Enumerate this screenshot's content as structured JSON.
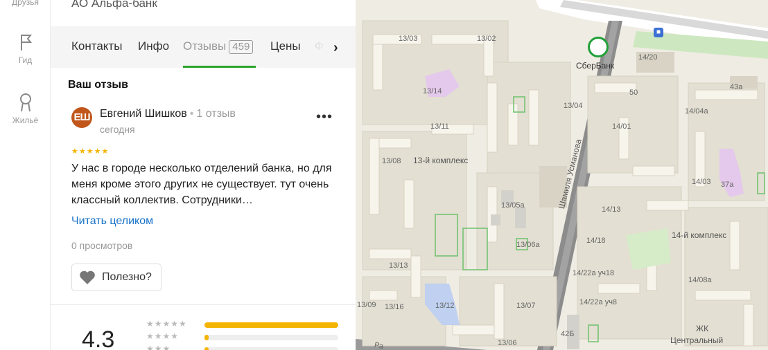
{
  "rail": {
    "friends_label": "Друзья",
    "guide_label": "Гид",
    "housing_label": "Жильё"
  },
  "org": {
    "name": "АО Альфа-банк"
  },
  "tabs": [
    {
      "label": "Контакты"
    },
    {
      "label": "Инфо"
    },
    {
      "label": "Отзывы",
      "count": "459"
    },
    {
      "label": "Цены"
    },
    {
      "label": "Ф"
    }
  ],
  "review": {
    "section_title": "Ваш отзыв",
    "avatar_initials": "ЕШ",
    "author": "Евгений Шишков",
    "separator": "•",
    "author_reviews": "1 отзыв",
    "date": "сегодня",
    "stars": "★★★★★",
    "rating": 5,
    "text": "У нас в городе несколько отделений банка, но для меня кроме этого других не существует. тут очень классный коллектив. Сотрудники…",
    "read_full": "Читать целиком",
    "views": "0 просмотров",
    "useful": "Полезно?",
    "more": "•••"
  },
  "rating_summary": {
    "score": "4.3",
    "distribution": [
      {
        "stars": "★★★★★",
        "fraction": 1.0
      },
      {
        "stars": "★★★★",
        "fraction": 0.03
      },
      {
        "stars": "★★★",
        "fraction": 0.03
      }
    ]
  },
  "map": {
    "labels": [
      "13/03",
      "13/02",
      "СберБанк",
      "14/20",
      "13/14",
      "50",
      "43а",
      "13/04",
      "14/04а",
      "13/11",
      "14/01",
      "13/08",
      "13-й комплекс",
      "14/03",
      "37а",
      "13/05а",
      "14/13",
      "14-й комплекс",
      "14/18",
      "13/06а",
      "13/13",
      "14/22а уч18",
      "14/08а",
      "13/09",
      "13/16",
      "13/12",
      "13/07",
      "14/22а уч8",
      "ЖК",
      "Центральный",
      "42Б",
      "13/06",
      "Ра"
    ],
    "street": "Шамиля Усманова",
    "brand_color": "#21a038"
  },
  "colors": {
    "accent_green": "#2aa32a",
    "link": "#1a73c7",
    "star": "#f4b400",
    "avatar": "#c0561b"
  }
}
